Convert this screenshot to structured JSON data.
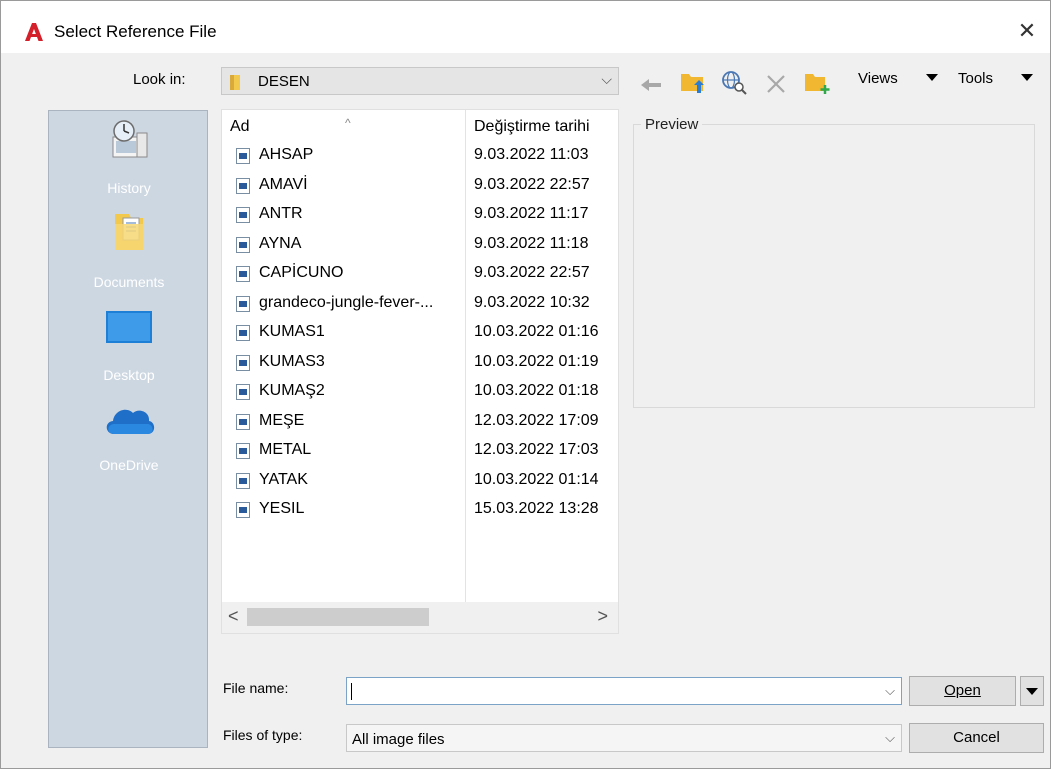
{
  "window": {
    "title": "Select Reference File",
    "close_glyph": "✕"
  },
  "toolbar": {
    "look_in_label": "Look in:",
    "look_in_value": "DESEN",
    "views_label": "Views",
    "tools_label": "Tools",
    "icons": [
      "back-arrow-icon",
      "up-folder-icon",
      "search-web-icon",
      "delete-icon",
      "new-folder-icon"
    ]
  },
  "places": [
    {
      "label": "History",
      "icon": "history-icon"
    },
    {
      "label": "Documents",
      "icon": "documents-icon"
    },
    {
      "label": "Desktop",
      "icon": "desktop-icon"
    },
    {
      "label": "OneDrive",
      "icon": "onedrive-icon"
    }
  ],
  "file_list": {
    "columns": {
      "name": "Ad",
      "date": "Değiştirme tarihi"
    },
    "rows": [
      {
        "name": "AHSAP",
        "date": "9.03.2022 11:03"
      },
      {
        "name": "AMAVİ",
        "date": "9.03.2022 22:57"
      },
      {
        "name": "ANTR",
        "date": "9.03.2022 11:17"
      },
      {
        "name": "AYNA",
        "date": "9.03.2022 11:18"
      },
      {
        "name": "CAPİCUNO",
        "date": "9.03.2022 22:57"
      },
      {
        "name": "grandeco-jungle-fever-...",
        "date": "9.03.2022 10:32"
      },
      {
        "name": "KUMAS1",
        "date": "10.03.2022 01:16"
      },
      {
        "name": "KUMAS3",
        "date": "10.03.2022 01:19"
      },
      {
        "name": "KUMAŞ2",
        "date": "10.03.2022 01:18"
      },
      {
        "name": "MEŞE",
        "date": "12.03.2022 17:09"
      },
      {
        "name": "METAL",
        "date": "12.03.2022 17:03"
      },
      {
        "name": "YATAK",
        "date": "10.03.2022 01:14"
      },
      {
        "name": "YESIL",
        "date": "15.03.2022 13:28"
      }
    ]
  },
  "preview": {
    "label": "Preview"
  },
  "form": {
    "file_name_label": "File name:",
    "file_name_value": "",
    "file_type_label": "Files of type:",
    "file_type_value": "All image files"
  },
  "buttons": {
    "open": "Open",
    "cancel": "Cancel"
  },
  "colors": {
    "places_bg": "#cdd7e2",
    "autocad_red": "#d4202a",
    "folder_yellow": "#f2c94c",
    "onedrive_blue": "#2b7cd3"
  }
}
